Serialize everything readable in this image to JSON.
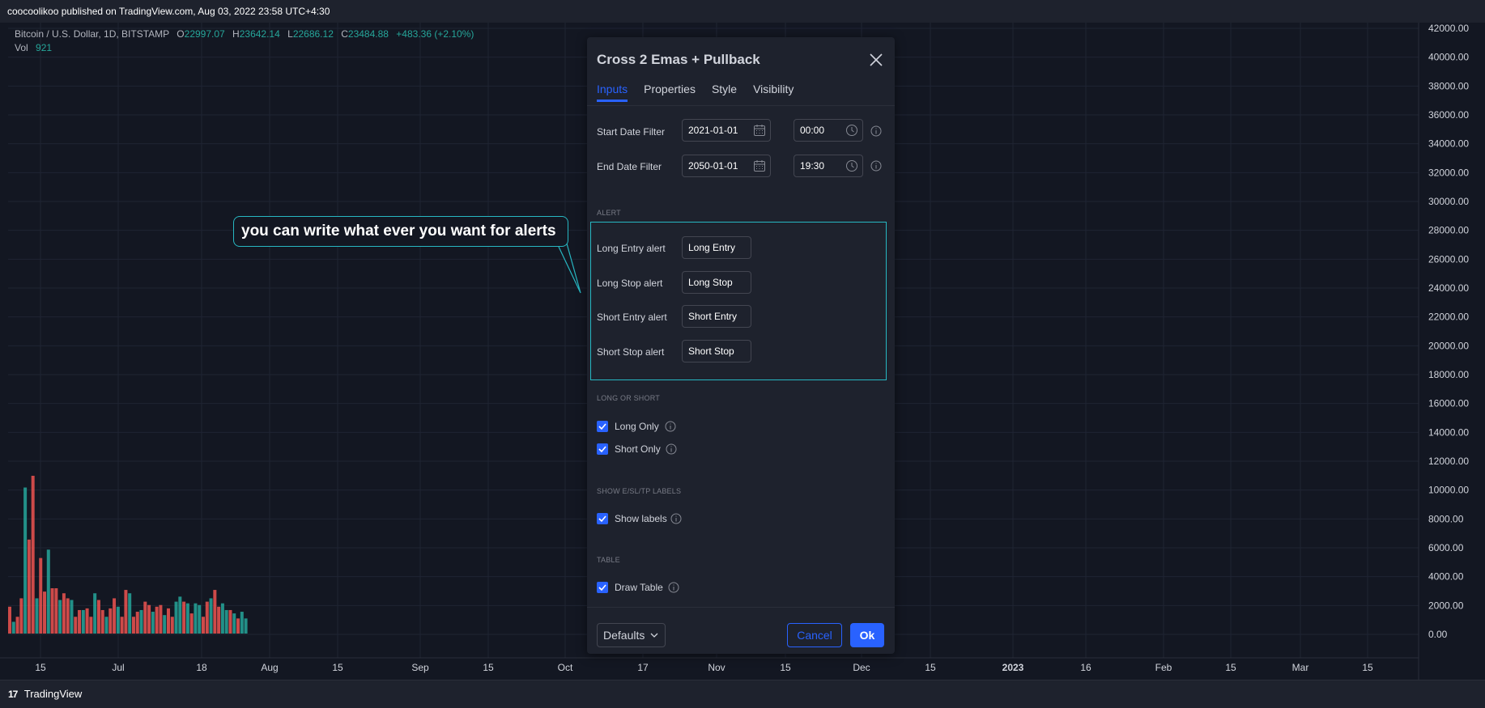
{
  "header": {
    "publish_text": "coocoolikoo published on TradingView.com, Aug 03, 2022 23:58 UTC+4:30"
  },
  "legend": {
    "symbol": "Bitcoin / U.S. Dollar, 1D, BITSTAMP",
    "open_label": "O",
    "open": "22997.07",
    "high_label": "H",
    "high": "23642.14",
    "low_label": "L",
    "low": "22686.12",
    "close_label": "C",
    "close": "23484.88",
    "change": "+483.36 (+2.10%)",
    "vol_label": "Vol",
    "vol": "921"
  },
  "footer": {
    "brand": "TradingView",
    "logo": "17"
  },
  "annotation": {
    "text": "you can write what ever you want for alerts"
  },
  "dialog": {
    "title": "Cross 2 Emas + Pullback",
    "tabs": [
      "Inputs",
      "Properties",
      "Style",
      "Visibility"
    ],
    "start_label": "Start Date Filter",
    "start_date": "2021-01-01",
    "start_time": "00:00",
    "end_label": "End Date Filter",
    "end_date": "2050-01-01",
    "end_time": "19:30",
    "section_alert": "ALERT",
    "alerts": [
      {
        "label": "Long Entry alert",
        "value": "Long Entry"
      },
      {
        "label": "Long Stop alert",
        "value": "Long Stop"
      },
      {
        "label": "Short Entry alert",
        "value": "Short Entry"
      },
      {
        "label": "Short Stop alert",
        "value": "Short Stop"
      }
    ],
    "section_long_short": "LONG OR SHORT",
    "long_only": "Long Only",
    "short_only": "Short Only",
    "section_labels": "SHOW E/SL/TP LABELS",
    "show_labels": "Show labels",
    "section_table": "TABLE",
    "draw_table": "Draw Table",
    "defaults": "Defaults",
    "cancel": "Cancel",
    "ok": "Ok"
  },
  "chart_data": {
    "type": "bar",
    "price_axis": [
      "42000.00",
      "40000.00",
      "38000.00",
      "36000.00",
      "34000.00",
      "32000.00",
      "30000.00",
      "28000.00",
      "26000.00",
      "24000.00",
      "22000.00",
      "20000.00",
      "18000.00",
      "16000.00",
      "14000.00",
      "12000.00",
      "10000.00",
      "8000.00",
      "6000.00",
      "4000.00",
      "2000.00",
      "0.00"
    ],
    "time_axis": [
      "15",
      "Jul",
      "18",
      "Aug",
      "15",
      "Sep",
      "15",
      "Oct",
      "17",
      "Nov",
      "15",
      "Dec",
      "15",
      "2023",
      "16",
      "Feb",
      "15",
      "Mar",
      "15"
    ],
    "volume_colors": {
      "up": "#26a69a",
      "down": "#ef5350"
    },
    "volume": [
      1600,
      700,
      1000,
      2100,
      8700,
      5600,
      9400,
      2100,
      4500,
      2500,
      5000,
      2700,
      2700,
      2000,
      2400,
      2100,
      2000,
      1000,
      1400,
      1400,
      1500,
      1000,
      2400,
      2000,
      1400,
      1000,
      1500,
      2100,
      1600,
      1000,
      2600,
      2400,
      1000,
      1300,
      1400,
      1900,
      1700,
      1300,
      1600,
      1700,
      1100,
      1500,
      1000,
      1900,
      2200,
      1900,
      1800,
      1200,
      1800,
      1700,
      1000,
      1900,
      2100,
      2600,
      1600,
      1800,
      1400,
      1400,
      1200,
      900,
      1300,
      900
    ]
  }
}
